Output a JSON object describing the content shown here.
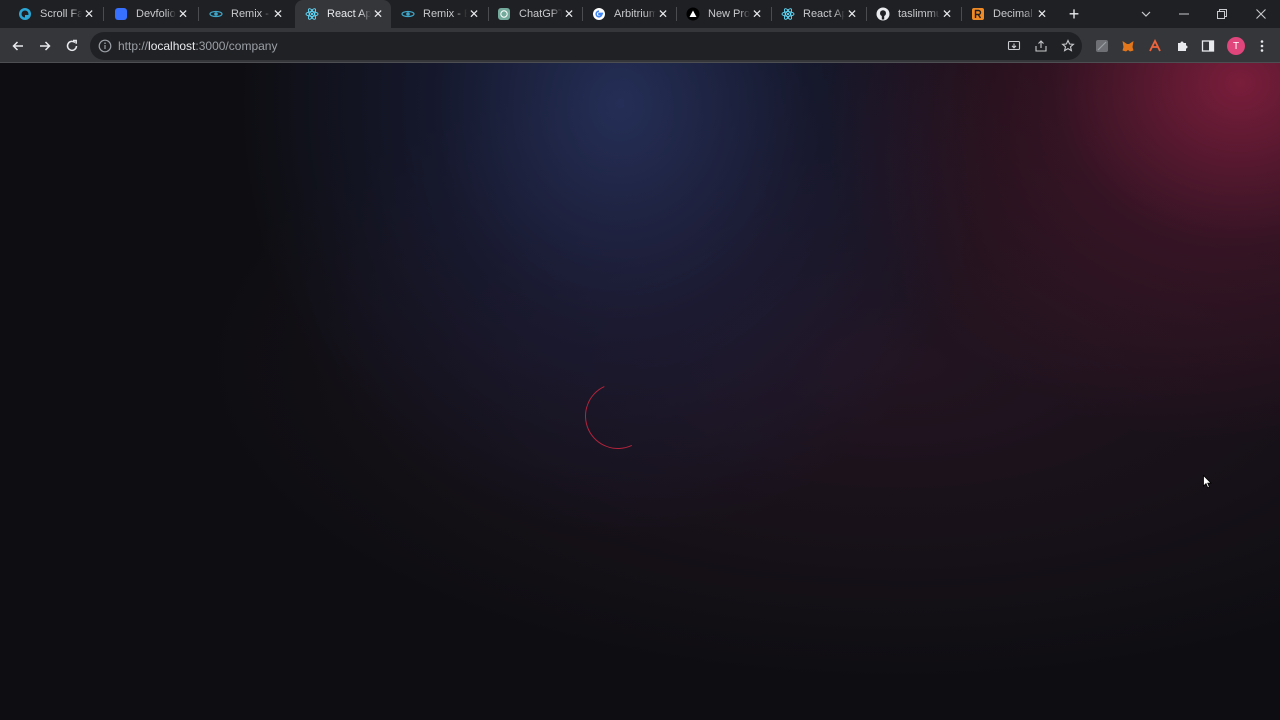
{
  "browser": {
    "tabs": [
      {
        "title": "Scroll Faucet",
        "icon": "scroll-icon",
        "active": false
      },
      {
        "title": "Devfolio",
        "icon": "devfolio-icon",
        "active": false
      },
      {
        "title": "Remix - Ethereum IDE",
        "icon": "remix-icon",
        "active": false
      },
      {
        "title": "React App",
        "icon": "react-icon",
        "active": true
      },
      {
        "title": "Remix - Ethereum IDE",
        "icon": "remix-icon",
        "active": false
      },
      {
        "title": "ChatGPT",
        "icon": "chatgpt-icon",
        "active": false
      },
      {
        "title": "Arbitrium",
        "icon": "google-icon",
        "active": false
      },
      {
        "title": "New Project",
        "icon": "vercel-icon",
        "active": false
      },
      {
        "title": "React App",
        "icon": "react-icon",
        "active": false
      },
      {
        "title": "taslimmu",
        "icon": "github-icon",
        "active": false
      },
      {
        "title": "Decimal",
        "icon": "r-icon",
        "active": false
      }
    ],
    "close_glyph": "✕",
    "newtab_glyph": "+",
    "address": {
      "scheme": "http://",
      "host": "localhost",
      "path": ":3000/company"
    },
    "profile_initial": "T",
    "colors": {
      "tabstrip": "#1f2023",
      "toolbar": "#35363a",
      "accent_spinner": "#b3243b",
      "avatar": "#e0457b"
    }
  },
  "page": {
    "state": "loading",
    "spinner_icon": "loading-spinner-icon"
  }
}
